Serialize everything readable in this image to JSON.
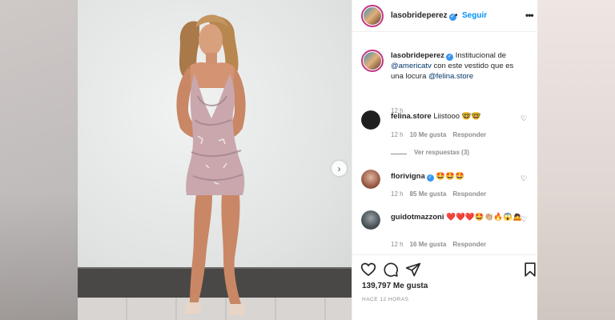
{
  "post": {
    "username": "lasobrideperez",
    "follow_label": "Seguir",
    "separator": "•",
    "more_label": "•••",
    "verified_mark": "✓",
    "caption": {
      "username": "lasobrideperez",
      "text_before": "Institucional de ",
      "mention1": "@americatv",
      "text_middle": " con este vestido que es una locura ",
      "mention2": "@felina.store",
      "time": "12 h"
    },
    "next_icon": "chevron-right-icon",
    "next_glyph": "›"
  },
  "comments": [
    {
      "username": "felina.store",
      "text": "Liistooo 🤓🤓",
      "time": "12 h",
      "likes": "10 Me gusta",
      "reply": "Responder",
      "view_replies": "Ver respuestas (3)",
      "verified": false
    },
    {
      "username": "florivigna",
      "text": "🤩🤩🤩",
      "time": "12 h",
      "likes": "85 Me gusta",
      "reply": "Responder",
      "verified": true
    },
    {
      "username": "guidotmazzoni",
      "text": "❤️❤️❤️🤩👏🏼🔥😱🙇",
      "time": "12 h",
      "likes": "16 Me gusta",
      "reply": "Responder",
      "verified": false
    }
  ],
  "actions": {
    "icons": [
      "heart-icon",
      "comment-icon",
      "share-icon",
      "bookmark-icon"
    ],
    "likes": "139,797 Me gusta",
    "time_ago": "HACE 12 HORAS"
  },
  "heart_glyph": "♡",
  "colors": {
    "accent": "#0095f6",
    "verified": "#3897f0",
    "mention": "#00376b",
    "meta": "#8e8e8e"
  }
}
